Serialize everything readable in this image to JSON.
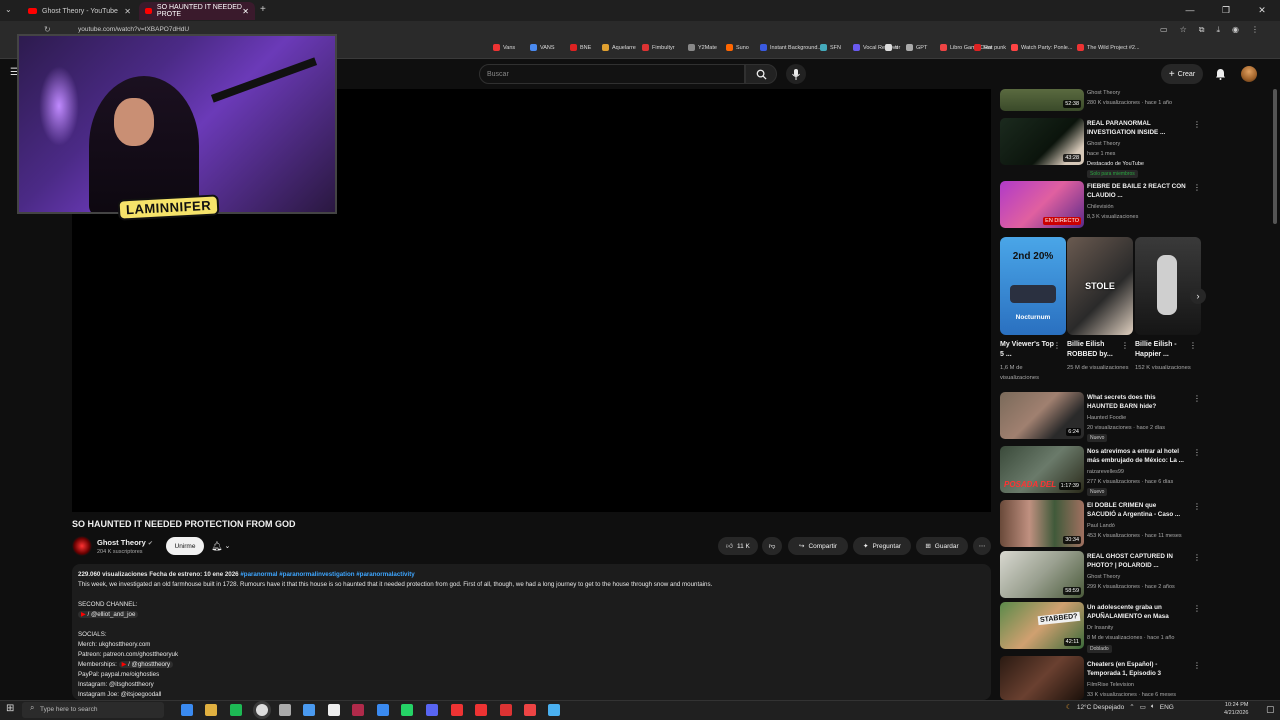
{
  "browser": {
    "tabs": [
      {
        "title": "Ghost Theory - YouTube",
        "active": false
      },
      {
        "title": "SO HAUNTED IT NEEDED PROTE",
        "active": true
      }
    ],
    "url": "youtube.com/watch?v=tXBAPO7dHdU",
    "bookmarks": [
      "Vans",
      "VANS",
      "BNE",
      "Aquelarre",
      "Fimbultyr",
      "Y2Mate",
      "Suno",
      "Instant Background...",
      "SFN",
      "Vocal Remover",
      "tt",
      "GPT",
      "Libro Game Over",
      "Rat punk",
      "Watch Party: Ponle...",
      "The Wild Project #2..."
    ]
  },
  "youtube": {
    "search_placeholder": "Buscar",
    "create_label": "Crear"
  },
  "overlay": {
    "streamer_name": "LAMINNIFER"
  },
  "video": {
    "title": "SO HAUNTED IT NEEDED PROTECTION FROM GOD",
    "channel": "Ghost Theory",
    "subscribers": "204 K suscriptores",
    "subscribe_label": "Unirme",
    "likes": "11 K",
    "share_label": "Compartir",
    "ask_label": "Preguntar",
    "save_label": "Guardar"
  },
  "description": {
    "stats": "229.060 visualizaciones  Fecha de estreno: 10 ene 2026",
    "tags": "#paranormal #paranormalinvestigation #paranormalactivity",
    "line1": "This week, we investigated an old farmhouse built in 1728. Rumours have it that this house is so haunted that it needed protection from god. First of all, though, we had a long journey to get to the house through snow and mountains.",
    "second_channel_header": "SECOND CHANNEL:",
    "second_channel": "/ @elliot_and_joe",
    "socials_header": "SOCIALS:",
    "merch": "Merch: ukghosttheory.com",
    "patreon": "Patreon: patreon.com/ghosttheoryuk",
    "memberships_label": "Memberships:",
    "memberships": "/ @ghosttheory",
    "paypal": "PayPal: paypal.me/oighosties",
    "instagram": "Instagram: @itsghosttheory",
    "instagram_joe": "Instagram Joe: @itsjoegoodall"
  },
  "sidebar": {
    "videos_top": [
      {
        "title": "",
        "channel": "Ghost Theory",
        "meta": "280 K visualizaciones · hace 1 año",
        "duration": "52:38"
      },
      {
        "title": "REAL PARANORMAL INVESTIGATION INSIDE ...",
        "channel": "Ghost Theory",
        "meta": "hace 1 mes",
        "extra": "Destacado de YouTube",
        "badge": "Solo para miembros",
        "duration": "43:28"
      },
      {
        "title": "FIEBRE DE BAILE 2 REACT CON CLAUDIO ...",
        "channel": "Chilevisión",
        "meta": "8,3 K visualizaciones",
        "duration": "EN DIRECTO"
      }
    ],
    "shorts": [
      {
        "title": "My Viewer's Top 5 ...",
        "meta": "1,6 M de visualizaciones",
        "thumb_text": "2nd 20%",
        "thumb_sub": "Nocturnum"
      },
      {
        "title": "Billie Eilish ROBBED by...",
        "meta": "25 M de visualizaciones",
        "thumb_text": "STOLE"
      },
      {
        "title": "Billie Eilish - Happier ...",
        "meta": "152 K visualizaciones"
      }
    ],
    "videos_bottom": [
      {
        "title": "What secrets does this HAUNTED BARN  hide?",
        "channel": "Haunted Foodie",
        "meta": "20 visualizaciones · hace 2 días",
        "badge": "Nuevo",
        "duration": "6:24"
      },
      {
        "title": "Nos atrevimos a entrar al hotel más embrujado de México: La ...",
        "channel": "raizarevelles99",
        "meta": "277 K visualizaciones · hace 6 días",
        "badge": "Nuevo",
        "duration": "1:17:39",
        "thumb_text": "POSADA DEL"
      },
      {
        "title": "El DOBLE CRIMEN que SACUDIÓ a Argentina - Caso ...",
        "channel": "Paul Landó",
        "meta": "453 K visualizaciones · hace 11 meses",
        "duration": "30:34"
      },
      {
        "title": "REAL GHOST CAPTURED IN PHOTO? | POLAROID ...",
        "channel": "Ghost Theory",
        "meta": "299 K visualizaciones · hace 2 años",
        "duration": "58:59"
      },
      {
        "title": "Un adolescente graba un APUÑALAMIENTO en Masa",
        "channel": "Dr Insanity",
        "meta": "8 M de visualizaciones · hace 1 año",
        "badge": "Doblado",
        "duration": "42:11",
        "thumb_text": "STABBED?"
      },
      {
        "title": "Cheaters (en Español) - Temporada 1, Episodio 3",
        "channel": "FilmRise Television",
        "meta": "33 K visualizaciones · hace 6 meses",
        "duration": ""
      }
    ]
  },
  "taskbar": {
    "search_placeholder": "Type here to search",
    "weather": "12°C  Despejado",
    "lang": "ENG",
    "time": "10:24 PM",
    "date": "4/21/2026"
  },
  "colors": {
    "accent": "#ff0000",
    "link": "#3ea6ff",
    "background": "#0f0f0f"
  }
}
